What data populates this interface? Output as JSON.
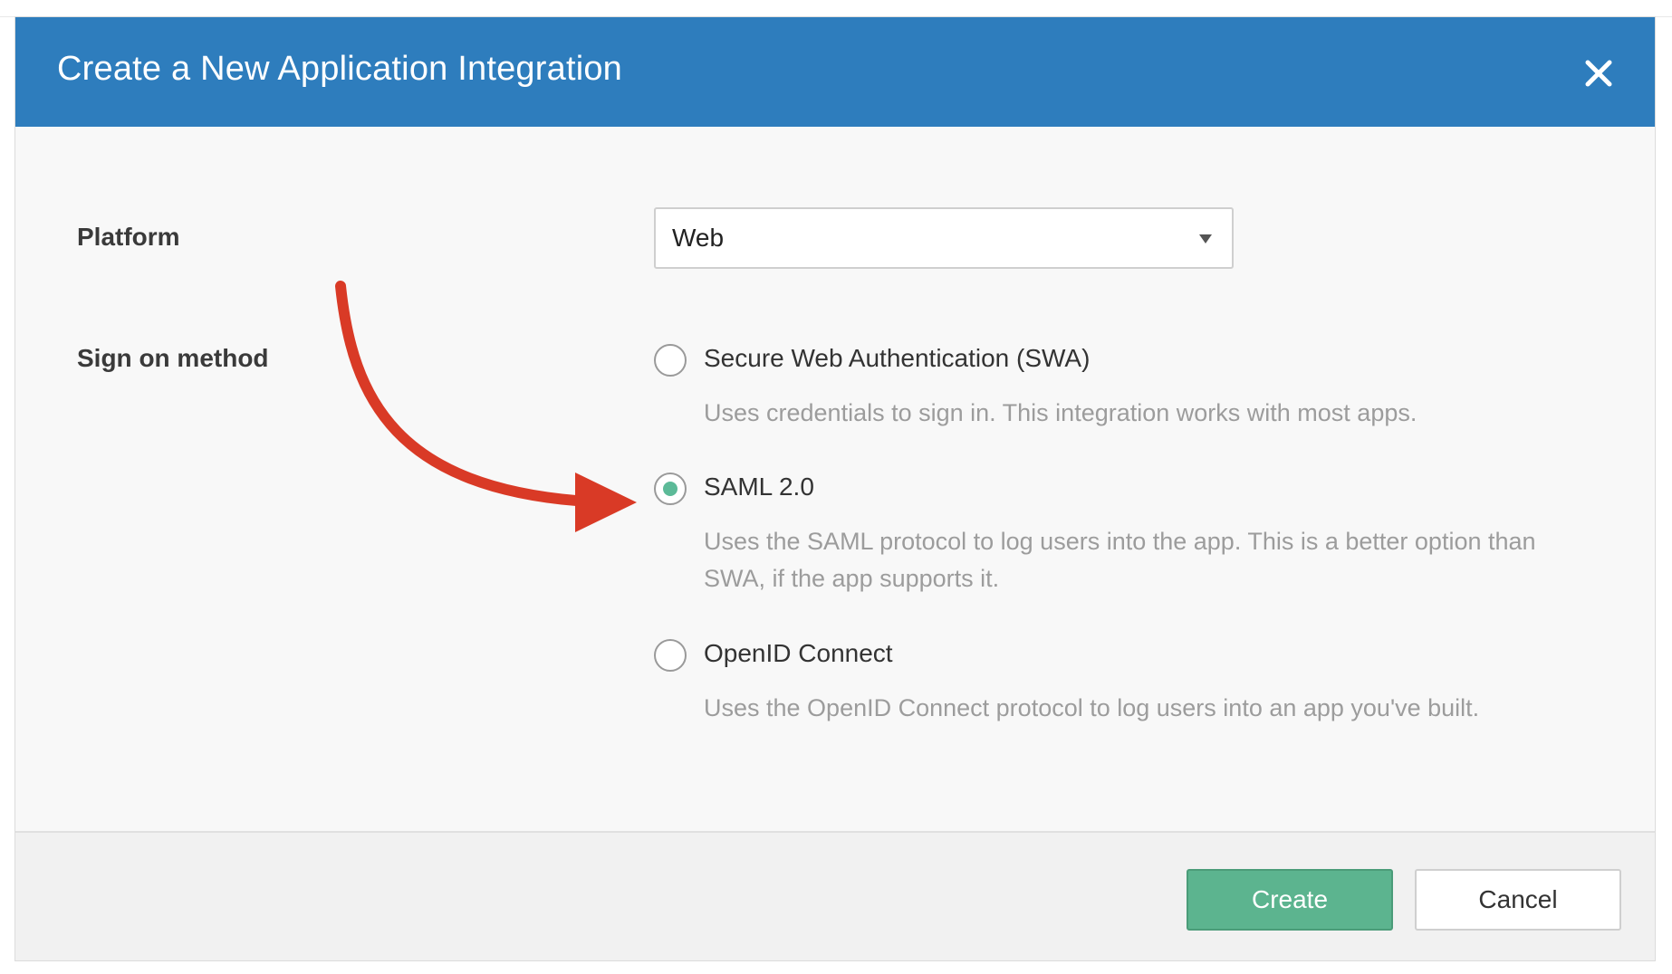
{
  "dialog": {
    "title": "Create a New Application Integration",
    "close_icon": "close-icon"
  },
  "form": {
    "platform_label": "Platform",
    "platform_value": "Web",
    "signon_label": "Sign on method",
    "options": [
      {
        "title": "Secure Web Authentication (SWA)",
        "description": "Uses credentials to sign in. This integration works with most apps.",
        "selected": false
      },
      {
        "title": "SAML 2.0",
        "description": "Uses the SAML protocol to log users into the app. This is a better option than SWA, if the app supports it.",
        "selected": true
      },
      {
        "title": "OpenID Connect",
        "description": "Uses the OpenID Connect protocol to log users into an app you've built.",
        "selected": false
      }
    ]
  },
  "footer": {
    "create_label": "Create",
    "cancel_label": "Cancel"
  },
  "colors": {
    "header": "#2e7dbd",
    "accent_green": "#5cb48f",
    "annotation_arrow": "#d93a26"
  }
}
